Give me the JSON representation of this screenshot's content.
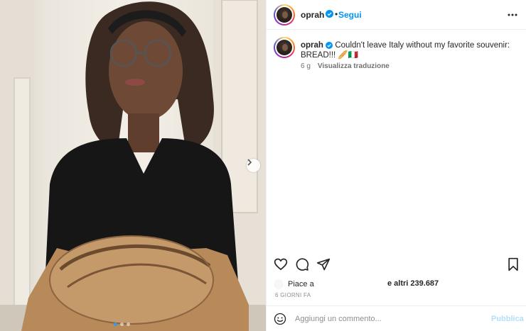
{
  "post": {
    "username": "oprah",
    "separator": "•",
    "follow_label": "Segui",
    "caption_text": "Couldn't leave Italy without my favorite souvenir: BREAD!!! 🥖🇮🇹",
    "caption_age": "6 g",
    "translate_label": "Visualizza traduzione",
    "likes_prefix": "Piace a",
    "likes_others": "e altri 239.687",
    "time_ago": "6 GIORNI FA",
    "comment_placeholder": "Aggiungi un commento...",
    "publish_label": "Pubblica"
  },
  "colors": {
    "accent": "#0095f6",
    "publish_disabled": "#b2dffc",
    "verified": "#0095f6"
  },
  "icons": [
    "verified-badge-icon",
    "more-options-icon",
    "heart-icon",
    "comment-icon",
    "share-icon",
    "bookmark-icon",
    "emoji-icon",
    "chevron-right-icon"
  ]
}
